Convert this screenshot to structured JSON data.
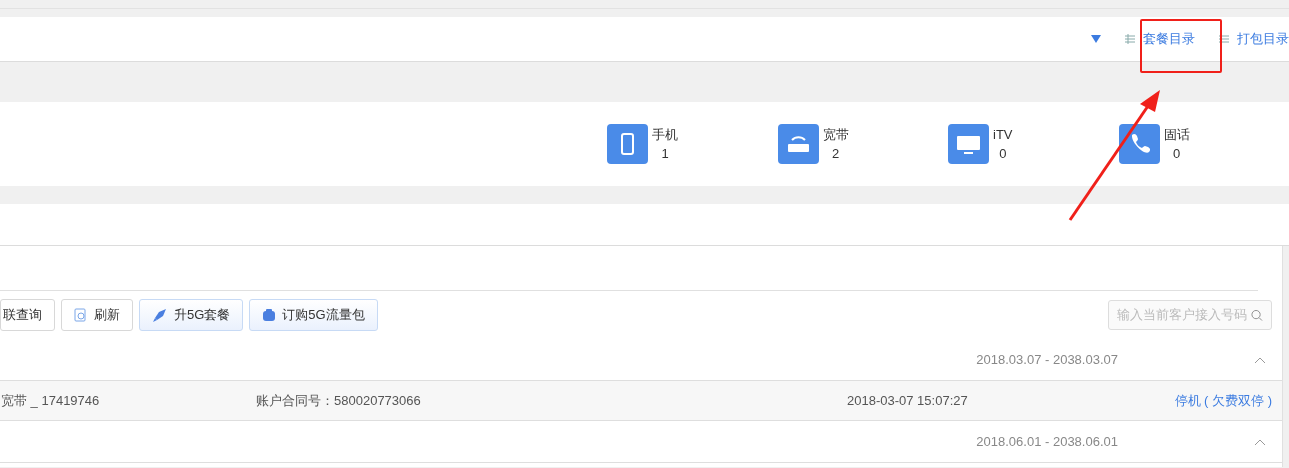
{
  "top_links": [
    {
      "label": "套餐目录",
      "kind": "grid"
    },
    {
      "label": "打包目录",
      "kind": "list"
    }
  ],
  "stats": [
    {
      "kind": "phone",
      "label": "手机",
      "count": "1"
    },
    {
      "kind": "broadband",
      "label": "宽带",
      "count": "2"
    },
    {
      "kind": "tv",
      "label": "iTV",
      "count": "0"
    },
    {
      "kind": "landline",
      "label": "固话",
      "count": "0"
    }
  ],
  "toolbar": [
    {
      "kind": "plain",
      "label": "联查询"
    },
    {
      "kind": "refresh",
      "label": "刷新"
    },
    {
      "kind": "rocket",
      "label": "升5G套餐"
    },
    {
      "kind": "bag",
      "label": "订购5G流量包"
    }
  ],
  "search": {
    "placeholder": "输入当前客户接入号码"
  },
  "rows": [
    {
      "kind": "period",
      "text": "2018.03.07 - 2038.03.07"
    },
    {
      "kind": "detail",
      "name": "宽带 _ 17419746",
      "contract": "账户合同号：580020773066",
      "time": "2018-03-07 15:07:27",
      "status": "停机 ( 欠费双停 )"
    },
    {
      "kind": "period",
      "text": "2018.06.01 - 2038.06.01"
    }
  ]
}
